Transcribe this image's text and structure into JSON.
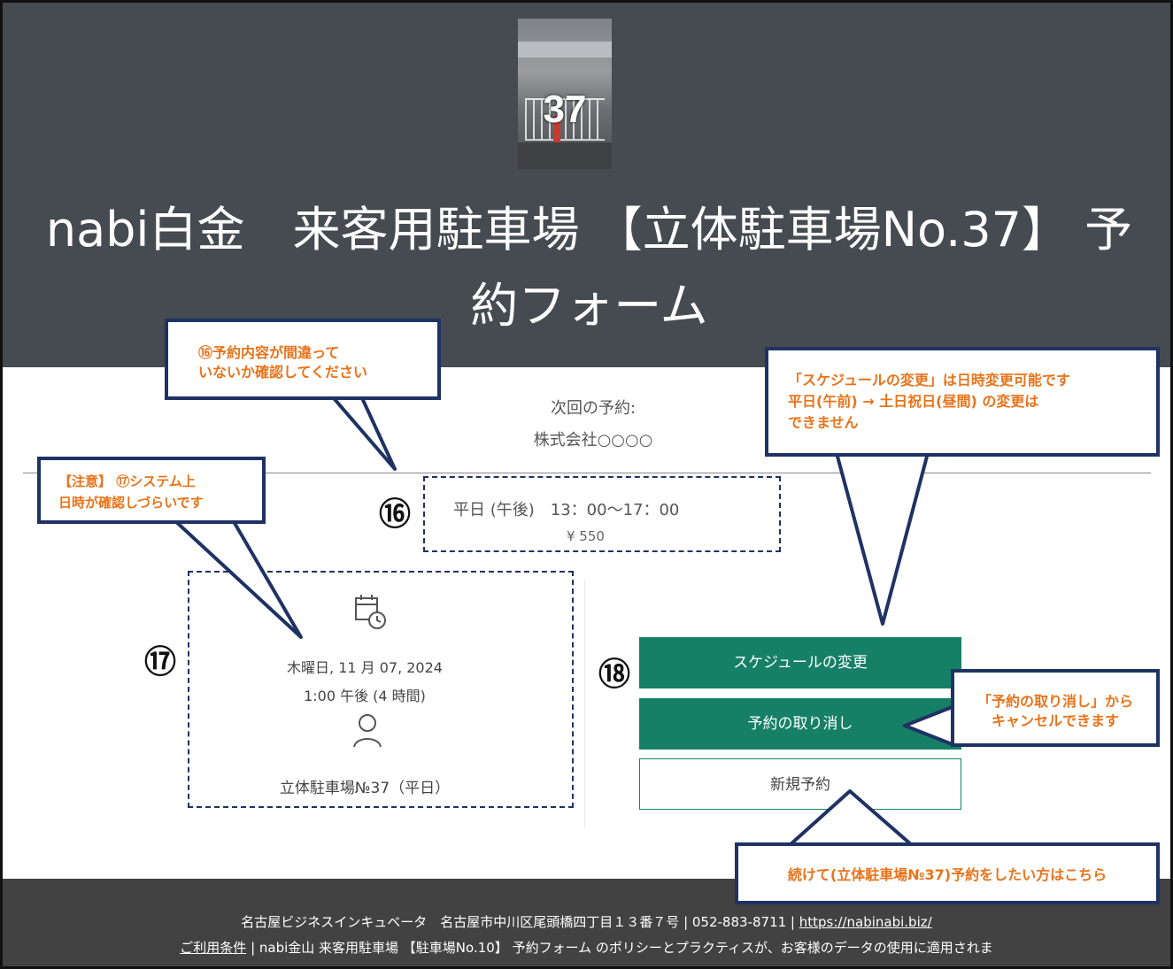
{
  "header": {
    "thumbnail_number": "37",
    "title_line1": "nabi白金　来客用駐車場 【立体駐車場No.37】 予",
    "title_line2": "約フォーム"
  },
  "next_booking": {
    "label": "次回の予約:",
    "company": "株式会社○○○○"
  },
  "price": {
    "marker": "⑯",
    "slot": "平日 (午後)　13：00～17：00",
    "amount": "¥ 550"
  },
  "booking_details": {
    "marker": "⑰",
    "calendar_icon": "calendar-clock-icon",
    "date": "木曜日, 11 月 07, 2024",
    "time": "1:00 午後 (4 時間)",
    "user_icon": "person-icon",
    "resource": "立体駐車場№37（平日）"
  },
  "actions": {
    "marker": "⑱",
    "change_schedule": "スケジュールの変更",
    "cancel_booking": "予約の取り消し",
    "new_booking": "新規予約"
  },
  "callouts": {
    "c16_line1": "⑯予約内容が間違って",
    "c16_line2": "いないか確認してください",
    "c17_line1": "【注意】 ⑰システム上",
    "c17_line2": "日時が確認しづらいです",
    "schedule_line1": "「スケジュールの変更」は日時変更可能です",
    "schedule_line2": "平日(午前) → 土日祝日(昼間) の変更は",
    "schedule_line3": "できません",
    "cancel_line1": "「予約の取り消し」から",
    "cancel_line2": "キャンセルできます",
    "new_line1": "続けて(立体駐車場№37)予約をしたい方はこちら"
  },
  "footer": {
    "line1_text": "名古屋ビジネスインキュベータ　名古屋市中川区尾頭橋四丁目１３番７号 | 052-883-8711 | ",
    "line1_link": "https://nabinabi.biz/",
    "line2_link": "ご利用条件",
    "line2_text": " | nabi金山 来客用駐車場 【駐車場No.10】 予約フォーム のポリシーとプラクティスが、お客様のデータの使用に適用されま"
  },
  "colors": {
    "header_bg": "#464a51",
    "accent_green": "#168067",
    "callout_border": "#1f3264",
    "callout_text": "#e8731a",
    "footer_bg": "#424242"
  }
}
